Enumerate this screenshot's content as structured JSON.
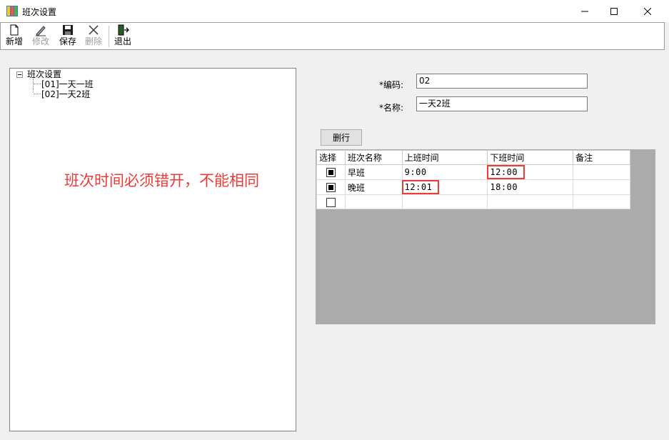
{
  "window": {
    "title": "班次设置"
  },
  "toolbar": {
    "buttons": [
      {
        "label": "新增",
        "icon": "new-document-icon",
        "enabled": true
      },
      {
        "label": "修改",
        "icon": "edit-pencil-icon",
        "enabled": false
      },
      {
        "label": "保存",
        "icon": "save-disk-icon",
        "enabled": true
      },
      {
        "label": "删除",
        "icon": "delete-x-icon",
        "enabled": false
      },
      {
        "label": "退出",
        "icon": "exit-door-icon",
        "enabled": true
      }
    ]
  },
  "tree": {
    "root": "班次设置",
    "children": [
      "[01]一天一班",
      "[02]一天2班"
    ]
  },
  "annotation": "班次时间必须错开，不能相同",
  "form": {
    "code_label": "*编码:",
    "code_value": "02",
    "name_label": "*名称:",
    "name_value": "一天2班"
  },
  "delete_row_label": "删行",
  "grid": {
    "headers": [
      "选择",
      "班次名称",
      "上班时间",
      "下班时间",
      "备注"
    ],
    "rows": [
      {
        "selected": true,
        "name": "早班",
        "start": "9:00",
        "end": "12:00",
        "note": "",
        "highlight_end": true
      },
      {
        "selected": true,
        "name": "晚班",
        "start": "12:01",
        "end": "18:00",
        "note": "",
        "highlight_start": true
      },
      {
        "selected": false,
        "name": "",
        "start": "",
        "end": "",
        "note": ""
      }
    ]
  },
  "colors": {
    "annotation": "#ee3a36",
    "grid_background": "#ababab"
  }
}
